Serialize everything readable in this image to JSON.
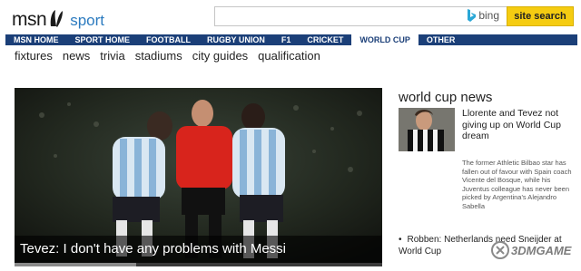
{
  "header": {
    "logo_msn": "msn",
    "logo_sport": "sport",
    "search_value": "",
    "bing_label": "bing",
    "search_button": "site search"
  },
  "nav": {
    "items": [
      {
        "label": "MSN HOME",
        "active": false
      },
      {
        "label": "SPORT HOME",
        "active": false
      },
      {
        "label": "FOOTBALL",
        "active": false
      },
      {
        "label": "RUGBY UNION",
        "active": false
      },
      {
        "label": "F1",
        "active": false
      },
      {
        "label": "CRICKET",
        "active": false
      },
      {
        "label": "WORLD CUP",
        "active": true
      },
      {
        "label": "OTHER",
        "active": false
      }
    ]
  },
  "subnav": {
    "items": [
      "fixtures",
      "news",
      "trivia",
      "stadiums",
      "city guides",
      "qualification"
    ]
  },
  "hero": {
    "caption": "Tevez: I don't have any problems with Messi",
    "progress": 0.33
  },
  "news": {
    "heading": "world cup news",
    "story_title": "Llorente and Tevez not giving up on World Cup dream",
    "story_summary": "The former Athletic Bilbao star has fallen out of favour with Spain coach Vicente del Bosque, while his Juventus colleague has never been picked by Argentina's Alejandro Sabella",
    "bullet": "Robben: Netherlands need Sneijder at World Cup"
  },
  "watermark": {
    "text": "3DMGAME"
  },
  "colors": {
    "nav_bg": "#1b3f78",
    "search_button": "#f5cc11",
    "logo_accent": "#2c7bbf"
  }
}
